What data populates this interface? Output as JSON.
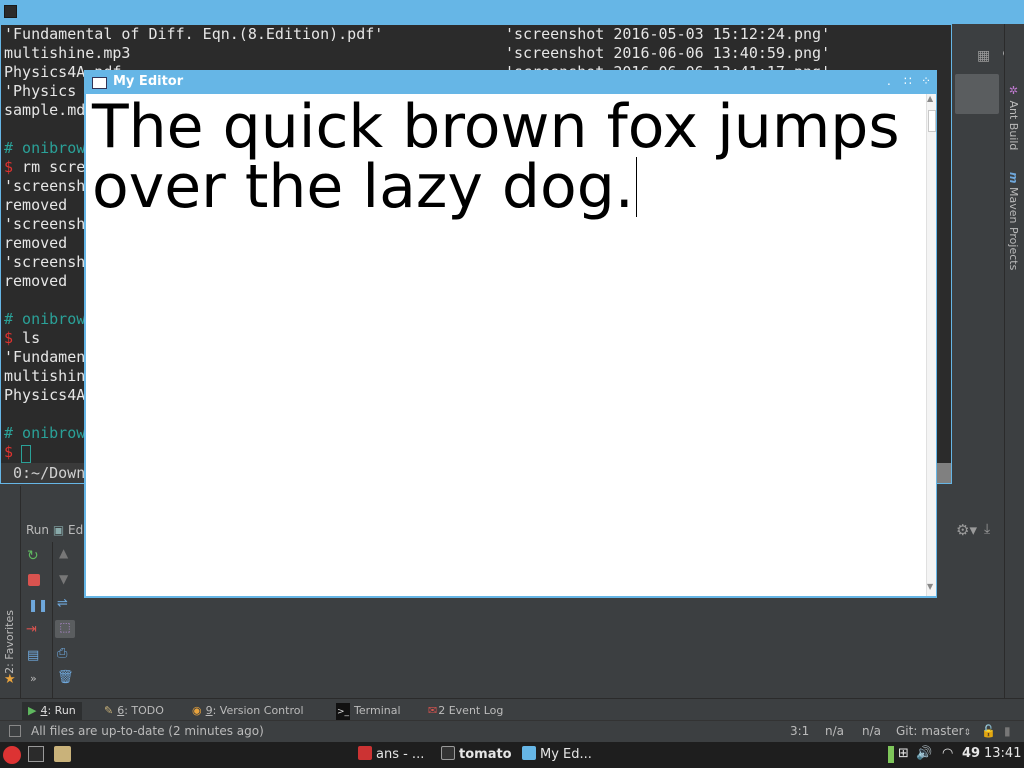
{
  "terminal": {
    "lines_left": [
      {
        "text": "'Fundamental of Diff. Eqn.(8.Edition).pdf'",
        "cls": ""
      },
      {
        "text": "multishine.mp3",
        "cls": ""
      },
      {
        "text": "Physics4A.pdf",
        "cls": ""
      },
      {
        "text": "'Physics",
        "cls": ""
      },
      {
        "text": "sample.md",
        "cls": ""
      },
      {
        "text": "",
        "cls": ""
      },
      {
        "text": "# onibrow",
        "cls": "green"
      },
      {
        "text": "$ rm scre",
        "cls": "prompt"
      },
      {
        "text": "'screensh",
        "cls": ""
      },
      {
        "text": "removed",
        "cls": ""
      },
      {
        "text": "'screensh",
        "cls": ""
      },
      {
        "text": "removed",
        "cls": ""
      },
      {
        "text": "'screensh",
        "cls": ""
      },
      {
        "text": "removed",
        "cls": ""
      },
      {
        "text": "",
        "cls": ""
      },
      {
        "text": "# onibrow",
        "cls": "green"
      },
      {
        "text": "$ ls",
        "cls": "prompt"
      },
      {
        "text": "'Fundamen",
        "cls": ""
      },
      {
        "text": "multishin",
        "cls": ""
      },
      {
        "text": "Physics4A",
        "cls": ""
      },
      {
        "text": "",
        "cls": ""
      },
      {
        "text": "# onibrow",
        "cls": "green"
      },
      {
        "text": "$",
        "cls": "prompt"
      }
    ],
    "lines_right": [
      "'screenshot 2016-05-03 15:12:24.png'",
      "'screenshot 2016-06-06 13:40:59.png'",
      "'screenshot 2016-06-06 13:41:17.png'"
    ],
    "status": "0:~/Down"
  },
  "ide": {
    "right_tabs": [
      "Ant Build",
      "Maven Projects"
    ],
    "run_label": "Run",
    "run_tab2": "Ed",
    "favorites_tab": "2: Favorites",
    "tool_tabs": [
      {
        "num": "4",
        "label": ": Run",
        "icon": "run-icon"
      },
      {
        "num": "6",
        "label": ": TODO",
        "icon": "todo-icon"
      },
      {
        "num": "9",
        "label": ": Version Control",
        "icon": "vcs-icon"
      },
      {
        "num": "",
        "label": "Terminal",
        "icon": "terminal-icon"
      },
      {
        "num": "2",
        "label": "Event Log",
        "icon": "event-log-icon"
      }
    ],
    "status_message": "All files are up-to-date (2 minutes ago)",
    "cursor_pos": "3:1",
    "na1": "n/a",
    "na2": "n/a",
    "git": "Git: master"
  },
  "editor": {
    "title": "My Editor",
    "text": "The quick brown fox jumps over the lazy dog."
  },
  "taskbar": {
    "tasks": [
      "ans - ...",
      "tomato",
      "My Ed..."
    ],
    "volume_level": "49",
    "clock": "13:41"
  },
  "colors": {
    "accent": "#66b6e6",
    "terminal_bg": "#2b2b2b",
    "ide_bg": "#3c3f41",
    "prompt_green": "#2aa198",
    "prompt_red": "#dc322f"
  }
}
